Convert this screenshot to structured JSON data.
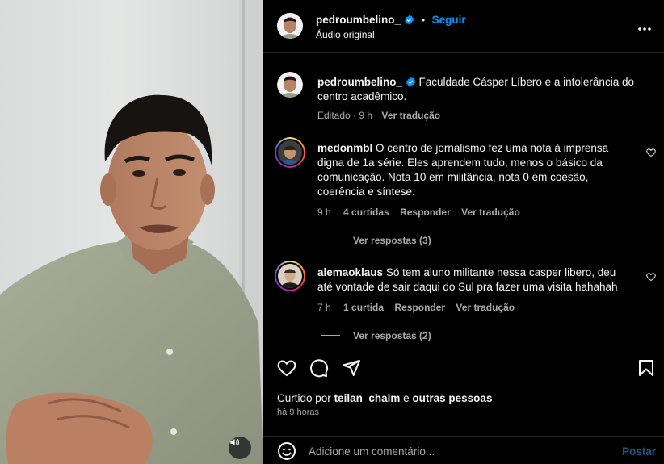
{
  "post": {
    "username": "pedroumbelino_",
    "separator": "•",
    "follow_label": "Seguir",
    "audio_label": "Áudio original",
    "caption": "Faculdade Cásper Líbero e a intolerância do centro acadêmico.",
    "edited": "Editado",
    "dot": "·",
    "time": "9 h",
    "translate": "Ver tradução"
  },
  "comments": [
    {
      "username": "medonmbl",
      "text": "O centro de jornalismo fez uma nota à imprensa digna de 1a série. Eles aprendem tudo, menos o básico da comunicação. Nota 10 em militância, nota 0 em coesão, coerência e síntese.",
      "time": "9 h",
      "likes": "4 curtidas",
      "reply": "Responder",
      "translate": "Ver tradução",
      "view_replies": "Ver respostas (3)"
    },
    {
      "username": "alemaoklaus",
      "text": "Só tem aluno militante nessa casper libero, deu até vontade de sair daqui do Sul pra fazer uma visita hahahah",
      "time": "7 h",
      "likes": "1 curtida",
      "reply": "Responder",
      "translate": "Ver tradução",
      "view_replies": "Ver respostas (2)"
    }
  ],
  "likes_line": {
    "prefix": "Curtido por",
    "user": "teilan_chaim",
    "conj": "e",
    "others": "outras pessoas"
  },
  "posted_ago": "há 9 horas",
  "composer": {
    "placeholder": "Adicione um comentário...",
    "post_label": "Postar"
  },
  "icons": {
    "more": "more-options-icon",
    "verified": "verified-badge-icon",
    "heart": "heart-icon",
    "comment": "comment-icon",
    "share": "share-icon",
    "save": "bookmark-icon",
    "emoji": "emoji-icon",
    "audio": "speaker-icon"
  },
  "colors": {
    "accent": "#0095f6",
    "background": "#000000",
    "muted": "#a8a8a8"
  }
}
